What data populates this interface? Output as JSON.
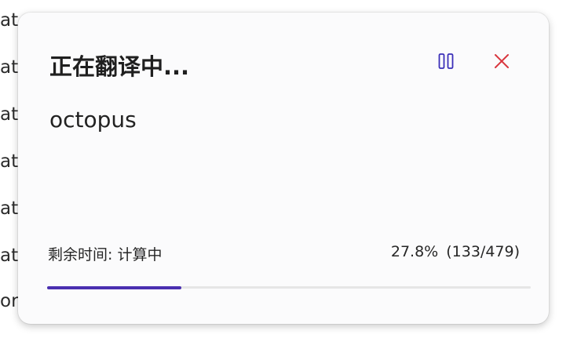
{
  "dialog": {
    "title": "正在翻译中...",
    "word": "octopus",
    "status_label": "剩余时间: 计算中",
    "percent_text": "27.8%",
    "count_text": "(133/479)",
    "progress_fraction": 0.278,
    "pause_icon": "pause-icon",
    "close_icon": "close-icon",
    "colors": {
      "accent": "#4a2fb0",
      "pause": "#3b2fb8",
      "close": "#d9363e"
    }
  },
  "background_rows": [
    "at",
    "at",
    "at",
    "at",
    "at",
    "at",
    "or"
  ]
}
